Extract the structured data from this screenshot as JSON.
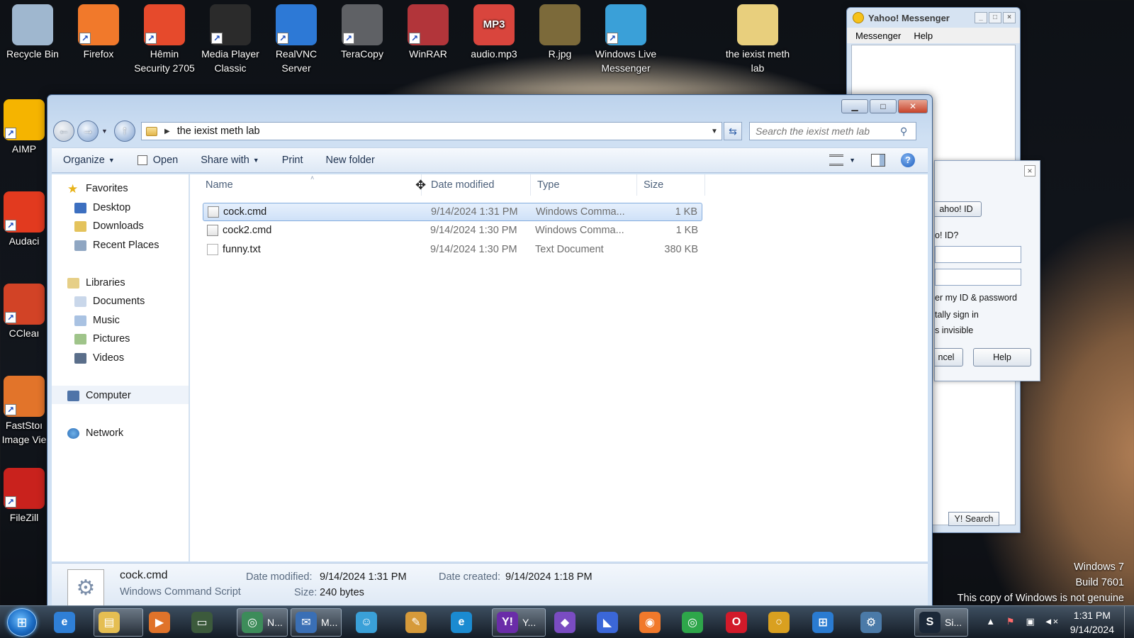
{
  "desktop": {
    "top_icons": [
      {
        "label": "Recycle Bin",
        "icon": "recycle-bin-icon",
        "color": "#9fb7cf"
      },
      {
        "label": "Firefox",
        "icon": "firefox-icon",
        "color": "#f1792b"
      },
      {
        "label": "Hêmin Security 2705",
        "icon": "hemin-security-icon",
        "color": "#e64a2c"
      },
      {
        "label": "Media Player Classic",
        "icon": "media-player-classic-icon",
        "color": "#2b2b2b"
      },
      {
        "label": "RealVNC Server",
        "icon": "realvnc-icon",
        "color": "#2d79d6"
      },
      {
        "label": "TeraCopy",
        "icon": "teracopy-icon",
        "color": "#5f6165"
      },
      {
        "label": "WinRAR",
        "icon": "winrar-icon",
        "color": "#b2353a"
      },
      {
        "label": "audio.mp3",
        "icon": "mp3-file-icon",
        "color": "#d9453d",
        "glyph_text": "MP3"
      },
      {
        "label": "R.jpg",
        "icon": "image-file-icon",
        "color": "#7c6a3a"
      },
      {
        "label": "Windows Live Messenger",
        "icon": "windows-live-messenger-icon",
        "color": "#3aa0d8"
      },
      {
        "label": "the iexist meth lab",
        "icon": "folder-icon",
        "color": "#e8cf7d"
      }
    ],
    "left_icons": [
      {
        "label": "AIMP",
        "icon": "aimp-icon",
        "color": "#f5b400"
      },
      {
        "label": "Audaci",
        "icon": "audacity-icon",
        "color": "#e23a1f"
      },
      {
        "label": "CCleaı",
        "icon": "ccleaner-icon",
        "color": "#d24326"
      },
      {
        "label": "FastStoı Image Vie",
        "icon": "faststone-icon",
        "color": "#e2742a"
      },
      {
        "label": "FileZill",
        "icon": "filezilla-icon",
        "color": "#c9221d"
      }
    ]
  },
  "yahoo": {
    "title": "Yahoo! Messenger",
    "menu": [
      "Messenger",
      "Help"
    ],
    "login": {
      "id_button": "ahoo! ID",
      "id_question": "o! ID?",
      "remember": "er my ID & password",
      "auto_sign": "tally sign in",
      "invisible": "s invisible",
      "cancel": "ncel",
      "help": "Help"
    },
    "search_button": "Y! Search"
  },
  "explorer": {
    "breadcrumb": "the iexist meth lab",
    "search_placeholder": "Search the iexist meth lab",
    "toolbar": {
      "organize": "Organize",
      "open": "Open",
      "share_with": "Share with",
      "print": "Print",
      "new_folder": "New folder"
    },
    "nav": {
      "favorites": "Favorites",
      "desktop": "Desktop",
      "downloads": "Downloads",
      "recent_places": "Recent Places",
      "libraries": "Libraries",
      "documents": "Documents",
      "music": "Music",
      "pictures": "Pictures",
      "videos": "Videos",
      "computer": "Computer",
      "network": "Network"
    },
    "columns": {
      "name": "Name",
      "date_modified": "Date modified",
      "type": "Type",
      "size": "Size"
    },
    "files": [
      {
        "name": "cock.cmd",
        "date": "9/14/2024 1:31 PM",
        "type": "Windows Comma...",
        "size": "1 KB",
        "selected": true
      },
      {
        "name": "cock2.cmd",
        "date": "9/14/2024 1:30 PM",
        "type": "Windows Comma...",
        "size": "1 KB",
        "selected": false
      },
      {
        "name": "funny.txt",
        "date": "9/14/2024 1:30 PM",
        "type": "Text Document",
        "size": "380 KB",
        "selected": false
      }
    ],
    "details": {
      "filename": "cock.cmd",
      "filetype": "Windows Command Script",
      "date_modified_label": "Date modified:",
      "date_modified": "9/14/2024 1:31 PM",
      "date_created_label": "Date created:",
      "date_created": "9/14/2024 1:18 PM",
      "size_label": "Size:",
      "size": "240 bytes"
    }
  },
  "watermark": {
    "line1": "Windows 7",
    "line2": "Build 7601",
    "line3": "This copy of Windows is not genuine"
  },
  "taskbar": {
    "buttons": [
      {
        "icon": "internet-explorer-icon",
        "label": "",
        "color": "#2f7fd6",
        "glyph": "e"
      },
      {
        "icon": "windows-explorer-icon",
        "label": "",
        "color": "#e5be52",
        "glyph": "▤",
        "boxed": true
      },
      {
        "icon": "media-player-icon",
        "label": "",
        "color": "#e0732a",
        "glyph": "▶"
      },
      {
        "icon": "terminal-icon",
        "label": "",
        "color": "#3c5a3c",
        "glyph": "▭"
      },
      {
        "icon": "network-app-icon",
        "label": "N...",
        "color": "#3d8c5a",
        "glyph": "◎",
        "boxed": true
      },
      {
        "icon": "mail-app-icon",
        "label": "M...",
        "color": "#3a6fb5",
        "glyph": "✉",
        "boxed": true
      },
      {
        "icon": "messenger-people-icon",
        "label": "",
        "color": "#3aa0d8",
        "glyph": "☺"
      },
      {
        "icon": "paint-icon",
        "label": "",
        "color": "#d69a3a",
        "glyph": "✎"
      },
      {
        "icon": "edge-icon",
        "label": "",
        "color": "#1b8bd1",
        "glyph": "e"
      },
      {
        "icon": "yahoo-messenger-icon",
        "label": "Y...",
        "color": "#6a2ca8",
        "glyph": "Y!",
        "boxed": true
      },
      {
        "icon": "visual-studio-icon",
        "label": "",
        "color": "#7a4cc2",
        "glyph": "◆"
      },
      {
        "icon": "app-blue-icon",
        "label": "",
        "color": "#3b67d8",
        "glyph": "◣"
      },
      {
        "icon": "firefox-icon",
        "label": "",
        "color": "#f1792b",
        "glyph": "◉"
      },
      {
        "icon": "chrome-icon",
        "label": "",
        "color": "#2ea64a",
        "glyph": "◎"
      },
      {
        "icon": "opera-icon",
        "label": "",
        "color": "#d21a2a",
        "glyph": "O"
      },
      {
        "icon": "ring-app-icon",
        "label": "",
        "color": "#d9a020",
        "glyph": "○"
      },
      {
        "icon": "windows-logo-icon",
        "label": "",
        "color": "#2a7bd1",
        "glyph": "⊞"
      },
      {
        "icon": "network-tool-icon",
        "label": "",
        "color": "#4b7aa8",
        "glyph": "⚙"
      },
      {
        "icon": "steam-icon",
        "label": "Si...",
        "color": "#1b2838",
        "glyph": "S",
        "boxed": true
      }
    ],
    "clock_time": "1:31 PM",
    "clock_date": "9/14/2024"
  }
}
